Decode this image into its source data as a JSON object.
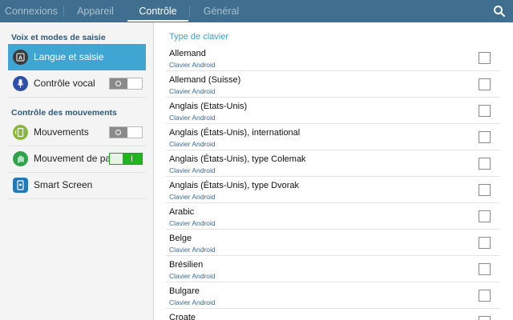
{
  "tabs": [
    {
      "label": "Connexions",
      "active": false
    },
    {
      "label": "Appareil",
      "active": false
    },
    {
      "label": "Contrôle",
      "active": true
    },
    {
      "label": "Général",
      "active": false
    }
  ],
  "left_panel": {
    "section1_title": "Voix et modes de saisie",
    "section2_title": "Contrôle des mouvements",
    "items": [
      {
        "label": "Langue et saisie",
        "icon": "keyboard-a-icon",
        "selected": true
      },
      {
        "label": "Contrôle vocal",
        "icon": "microphone-icon",
        "toggle_on": false
      },
      {
        "label": "Mouvements",
        "icon": "phone-motion-icon",
        "toggle_on": false
      },
      {
        "label": "Mouvement de paume",
        "icon": "palm-motion-icon",
        "toggle_on": true
      },
      {
        "label": "Smart Screen",
        "icon": "smart-screen-icon"
      }
    ]
  },
  "right_panel": {
    "header": "Type de clavier",
    "rows": [
      {
        "title": "Allemand",
        "subtitle": "Clavier Android",
        "checked": false
      },
      {
        "title": "Allemand (Suisse)",
        "subtitle": "Clavier Android",
        "checked": false
      },
      {
        "title": "Anglais (Etats-Unis)",
        "subtitle": "Clavier Android",
        "checked": false
      },
      {
        "title": "Anglais (États-Unis), international",
        "subtitle": "Clavier Android",
        "checked": false
      },
      {
        "title": "Anglais (États-Unis), type Colemak",
        "subtitle": "Clavier Android",
        "checked": false
      },
      {
        "title": "Anglais (États-Unis), type Dvorak",
        "subtitle": "Clavier Android",
        "checked": false
      },
      {
        "title": "Arabic",
        "subtitle": "Clavier Android",
        "checked": false
      },
      {
        "title": "Belge",
        "subtitle": "Clavier Android",
        "checked": false
      },
      {
        "title": "Brésilien",
        "subtitle": "Clavier Android",
        "checked": false
      },
      {
        "title": "Bulgare",
        "subtitle": "Clavier Android",
        "checked": false
      },
      {
        "title": "Croate",
        "subtitle": "Clavier Android",
        "checked": false
      }
    ]
  },
  "colors": {
    "topbar": "#3f6e8e",
    "selected_item": "#3fa6d4",
    "toggle_on": "#1fb51f",
    "section_title": "#2b5a7c",
    "header_accent": "#3a9fd0"
  }
}
